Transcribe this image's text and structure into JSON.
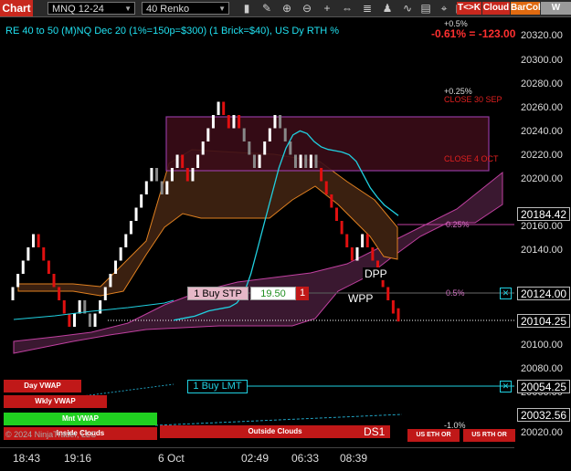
{
  "toolbar": {
    "chart_tab": "Chart",
    "instrument": "MNQ 12-24",
    "bar_type": "40 Renko",
    "buttons": [
      {
        "label": "T<>K",
        "color": "#c8281e"
      },
      {
        "label": "Cloud",
        "color": "#c8281e"
      },
      {
        "label": "BarCol",
        "color": "#e06a10"
      },
      {
        "label": "W VWAP",
        "color": "#9a9a9a"
      }
    ],
    "icons": [
      "chart-style-icon",
      "drawing-tools-icon",
      "zoom-in-icon",
      "zoom-out-icon",
      "crosshair-icon",
      "bar-spacing-icon",
      "properties-icon",
      "strategies-icon",
      "indicators-icon",
      "templates-icon",
      "global-crosshair-icon",
      "data-series-icon"
    ]
  },
  "header": {
    "title": "RE 40 to 50 (M)NQ Dec 20 (1%=150p=$300) (1 Brick=$40), US Dy RTH %",
    "pct_top": "+0.5%",
    "pct_change": "-0.61% = -123.00"
  },
  "annotations": {
    "pct_025_top": "+0.25%",
    "close_30_sep": "CLOSE 30 SEP",
    "close_4_oct": "CLOSE 4 OCT",
    "pct_025": "0.25%",
    "pct_05": "0.5%",
    "pct_neg_1": "-1.0%",
    "dpp": "DPP",
    "wpp": "WPP",
    "ds1": "DS1",
    "copyright": "© 2024 NinjaTrader, LLC"
  },
  "orders": {
    "stop": {
      "label": "1 Buy STP",
      "price": "19.50",
      "qty": "1",
      "price_label": "20124.00"
    },
    "limit": {
      "label": "1 Buy LMT",
      "price_label": "20054.25"
    }
  },
  "price_axis": {
    "ticks": [
      "20320.00",
      "20300.00",
      "20280.00",
      "20260.00",
      "20240.00",
      "20220.00",
      "20200.00",
      "20180.00",
      "20160.00",
      "20140.00",
      "20120.00",
      "20100.00",
      "20080.00",
      "20060.00",
      "20040.00",
      "20020.00"
    ],
    "current_price": "20104.25",
    "cyan_label": "20184.42",
    "lower_label": "20032.56"
  },
  "time_axis": [
    "18:43",
    "19:16",
    "6 Oct",
    "02:49",
    "06:33",
    "08:39"
  ],
  "bottom_panel": {
    "day_vwap": "Day VWAP",
    "wkly_vwap": "Wkly VWAP",
    "mnt_vwap": "Mnt VWAP",
    "inside_clouds": "Inside Clouds",
    "outside_clouds": "Outside Clouds",
    "us_eth_or": "US ETH OR",
    "us_rth_or": "US RTH OR"
  },
  "chart_data": {
    "type": "renko",
    "brick_size": 40,
    "ylim": [
      20010,
      20330
    ],
    "bricks": [
      {
        "dir": "up",
        "close": 20130
      },
      {
        "dir": "up",
        "close": 20140
      },
      {
        "dir": "up",
        "close": 20150
      },
      {
        "dir": "up",
        "close": 20160
      },
      {
        "dir": "up",
        "close": 20170
      },
      {
        "dir": "down",
        "close": 20160
      },
      {
        "dir": "down",
        "close": 20150
      },
      {
        "dir": "down",
        "close": 20140
      },
      {
        "dir": "down",
        "close": 20130
      },
      {
        "dir": "down",
        "close": 20120
      },
      {
        "dir": "down",
        "close": 20110
      },
      {
        "dir": "down",
        "close": 20100
      },
      {
        "dir": "up",
        "close": 20110
      },
      {
        "dir": "up",
        "close": 20120
      },
      {
        "dir": "down",
        "close": 20110
      },
      {
        "dir": "down",
        "close": 20100
      },
      {
        "dir": "up",
        "close": 20110
      },
      {
        "dir": "up",
        "close": 20120
      },
      {
        "dir": "up",
        "close": 20130
      },
      {
        "dir": "up",
        "close": 20140
      },
      {
        "dir": "up",
        "close": 20150
      },
      {
        "dir": "up",
        "close": 20160
      },
      {
        "dir": "up",
        "close": 20170
      },
      {
        "dir": "up",
        "close": 20180
      },
      {
        "dir": "up",
        "close": 20190
      },
      {
        "dir": "up",
        "close": 20200
      },
      {
        "dir": "up",
        "close": 20210
      },
      {
        "dir": "up",
        "close": 20220
      },
      {
        "dir": "down",
        "close": 20210
      },
      {
        "dir": "down",
        "close": 20200
      },
      {
        "dir": "up",
        "close": 20210
      },
      {
        "dir": "up",
        "close": 20220
      },
      {
        "dir": "up",
        "close": 20230
      },
      {
        "dir": "down",
        "close": 20220
      },
      {
        "dir": "down",
        "close": 20210
      },
      {
        "dir": "up",
        "close": 20220
      },
      {
        "dir": "up",
        "close": 20230
      },
      {
        "dir": "up",
        "close": 20240
      },
      {
        "dir": "up",
        "close": 20250
      },
      {
        "dir": "up",
        "close": 20260
      },
      {
        "dir": "up",
        "close": 20270
      },
      {
        "dir": "down",
        "close": 20260
      },
      {
        "dir": "down",
        "close": 20250
      },
      {
        "dir": "up",
        "close": 20260
      },
      {
        "dir": "down",
        "close": 20250
      },
      {
        "dir": "down",
        "close": 20240
      },
      {
        "dir": "down",
        "close": 20230
      },
      {
        "dir": "down",
        "close": 20220
      },
      {
        "dir": "up",
        "close": 20230
      },
      {
        "dir": "up",
        "close": 20240
      },
      {
        "dir": "up",
        "close": 20250
      },
      {
        "dir": "up",
        "close": 20260
      },
      {
        "dir": "down",
        "close": 20250
      },
      {
        "dir": "down",
        "close": 20240
      },
      {
        "dir": "down",
        "close": 20230
      },
      {
        "dir": "down",
        "close": 20220
      },
      {
        "dir": "up",
        "close": 20230
      },
      {
        "dir": "down",
        "close": 20220
      },
      {
        "dir": "up",
        "close": 20230
      },
      {
        "dir": "down",
        "close": 20220
      },
      {
        "dir": "down",
        "close": 20210
      },
      {
        "dir": "down",
        "close": 20200
      },
      {
        "dir": "down",
        "close": 20190
      },
      {
        "dir": "down",
        "close": 20180
      },
      {
        "dir": "down",
        "close": 20170
      },
      {
        "dir": "down",
        "close": 20160
      },
      {
        "dir": "down",
        "close": 20150
      },
      {
        "dir": "up",
        "close": 20160
      },
      {
        "dir": "up",
        "close": 20170
      },
      {
        "dir": "down",
        "close": 20160
      },
      {
        "dir": "down",
        "close": 20150
      },
      {
        "dir": "down",
        "close": 20140
      },
      {
        "dir": "down",
        "close": 20130
      },
      {
        "dir": "down",
        "close": 20120
      },
      {
        "dir": "down",
        "close": 20110
      },
      {
        "dir": "down",
        "close": 20104
      }
    ],
    "cyan_ma": [
      20105,
      20106,
      20107,
      20108,
      20110,
      20112,
      20113,
      20114,
      20115,
      20118,
      20125,
      20140,
      20160,
      20180,
      20200,
      20220,
      20235,
      20245,
      20248,
      20246,
      20240,
      20236,
      20234,
      20233,
      20232,
      20230,
      20225,
      20215,
      20205,
      20198,
      20192,
      20188,
      20184
    ],
    "colors": {
      "up": "#ffffff",
      "down": "#e01010",
      "neutral": "#888888",
      "cyan": "#20d0e0",
      "cloud": "#3c1a30",
      "orange": "#e08020"
    }
  }
}
